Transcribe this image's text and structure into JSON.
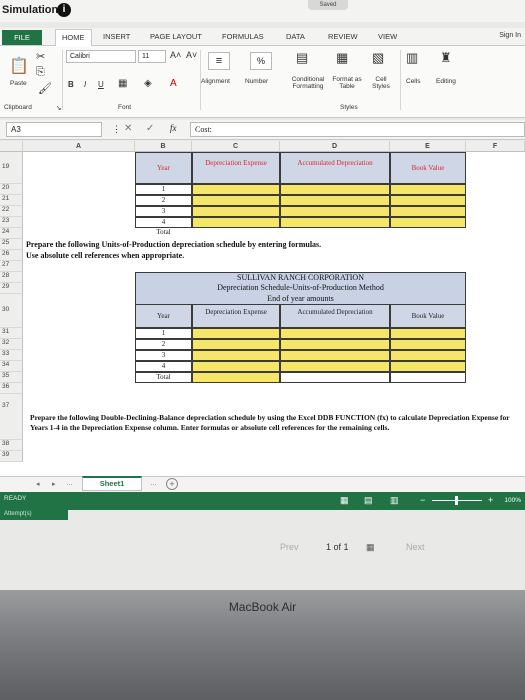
{
  "title_bar": {
    "title": "Simulation",
    "saved": "Saved"
  },
  "ribbon": {
    "tabs": [
      "FILE",
      "HOME",
      "INSERT",
      "PAGE LAYOUT",
      "FORMULAS",
      "DATA",
      "REVIEW",
      "VIEW"
    ],
    "sign_in": "Sign In",
    "font_name": "Calibri",
    "font_size": "11",
    "paste": "Paste",
    "bold": "B",
    "italic": "I",
    "underline": "U",
    "alignment": "Alignment",
    "number": "Number",
    "conditional_formatting": "Conditional Formatting",
    "format_as_table": "Format as Table",
    "cell_styles": "Cell Styles",
    "cells": "Cells",
    "editing": "Editing",
    "group_clipboard": "Clipboard",
    "group_font": "Font",
    "group_styles": "Styles",
    "percent": "%"
  },
  "formula_bar": {
    "name_box": "A3",
    "fx": "fx",
    "content": "Cost:"
  },
  "columns": [
    "A",
    "B",
    "C",
    "D",
    "E",
    "F"
  ],
  "rows": {
    "r19": "19",
    "r20": "20",
    "r21": "21",
    "r22": "22",
    "r23": "23",
    "r24": "24",
    "r25": "25",
    "r26": "26",
    "r27": "27",
    "r28": "28",
    "r29": "29",
    "r30": "30",
    "r31": "31",
    "r32": "32",
    "r33": "33",
    "r34": "34",
    "r35": "35",
    "r36": "36",
    "r37": "37",
    "r38": "38",
    "r39": "39"
  },
  "table1": {
    "year": "Year",
    "dep_expense": "Depreciation Expense",
    "acc_dep": "Accumulated Depreciation",
    "book_value": "Book Value",
    "years": [
      "1",
      "2",
      "3",
      "4"
    ],
    "total": "Total"
  },
  "instructions": {
    "line25": "Prepare the following Units-of-Production depreciation schedule by entering formulas.",
    "line26": "Use absolute cell references when appropriate.",
    "line37": "Prepare the following Double-Declining-Balance depreciation schedule by using the Excel DDB FUNCTION (fx) to calculate Depreciation Expense for Years 1-4 in the Depreciation Expense column. Enter formulas or absolute cell references for the remaining cells."
  },
  "table2": {
    "company": "SULLIVAN RANCH CORPORATION",
    "schedule": "Depreciation Schedule-Units-of-Production Method",
    "end_of_year": "End of year amounts",
    "year": "Year",
    "dep_expense": "Depreciation Expense",
    "acc_dep": "Accumulated Depreciation",
    "book_value": "Book Value",
    "years": [
      "1",
      "2",
      "3",
      "4"
    ],
    "total": "Total"
  },
  "sheet": {
    "tab": "Sheet1",
    "status": "READY",
    "attempts": "Attempt(s)",
    "zoom": "100%"
  },
  "pager": {
    "prev": "Prev",
    "current": "1 of 1",
    "next": "Next"
  },
  "device": {
    "label": "MacBook Air"
  }
}
